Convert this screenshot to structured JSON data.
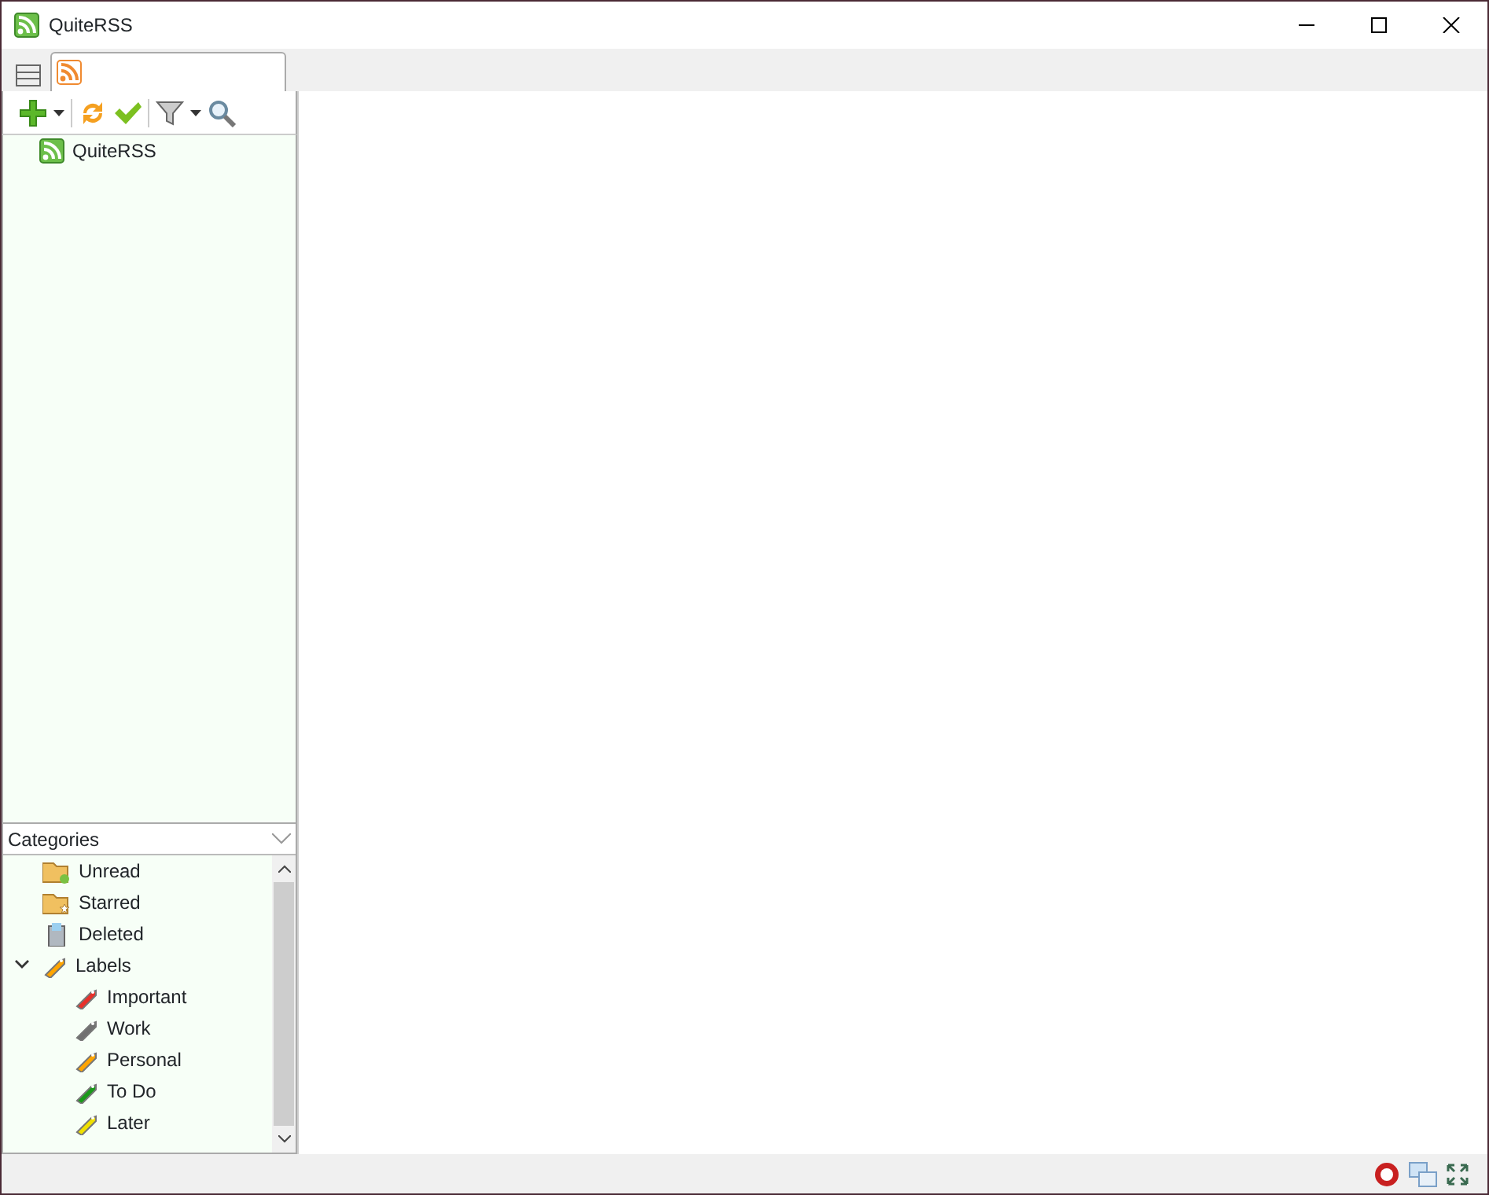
{
  "window": {
    "title": "QuiteRSS"
  },
  "feeds": [
    {
      "title": "QuiteRSS",
      "selected": false
    }
  ],
  "categories": {
    "title": "Categories",
    "items": [
      {
        "label": "Unread",
        "kind": "unread"
      },
      {
        "label": "Starred",
        "kind": "starred"
      },
      {
        "label": "Deleted",
        "kind": "deleted"
      },
      {
        "label": "Labels",
        "kind": "labels",
        "expanded": true,
        "color": "#ffa500",
        "children": [
          {
            "label": "Important",
            "kind": "label",
            "color": "#e8302a"
          },
          {
            "label": "Work",
            "kind": "label",
            "color": "#707070"
          },
          {
            "label": "Personal",
            "kind": "label",
            "color": "#ffa500"
          },
          {
            "label": "To Do",
            "kind": "label",
            "color": "#1a9a1a"
          },
          {
            "label": "Later",
            "kind": "label",
            "color": "#f0e000"
          }
        ]
      }
    ]
  }
}
